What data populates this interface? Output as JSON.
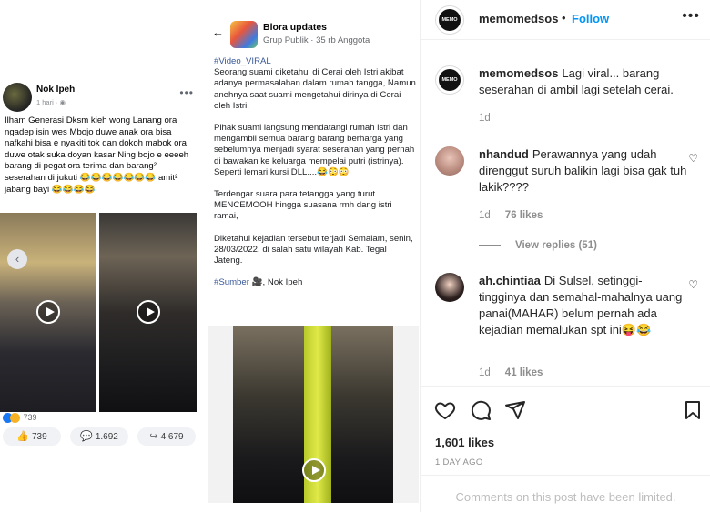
{
  "fb_post": {
    "author": "Nok Ipeh",
    "time": "1 hari",
    "text": "Ilham Generasi Dksm  kieh wong Lanang ora ngadep isin wes Mbojo duwe anak ora bisa nafkahi bisa e nyakiti tok dan dokoh mabok ora duwe otak suka doyan kasar Ning bojo e eeeeh barang di pegat ora terima dan barang² seserahan di jukuti 😂😂😂😂😂😂😂 amit² jabang bayi 😂😂😂😂",
    "reaction_count": "739",
    "actions": [
      {
        "icon": "👍",
        "label": "739"
      },
      {
        "icon": "💬",
        "label": "1.692"
      },
      {
        "icon": "↪",
        "label": "4.679"
      }
    ]
  },
  "group_post": {
    "group_name": "Blora updates",
    "group_meta": "Grup Publik  ·  35 rb Anggota",
    "hashtag": "#Video_VIRAL",
    "paragraphs": [
      "Seorang suami diketahui di Cerai oleh Istri akibat adanya permasalahan dalam rumah tangga, Namun anehnya saat suami mengetahui dirinya di Cerai oleh Istri.",
      "Pihak suami langsung mendatangi rumah istri dan mengambil semua barang barang berharga yang sebelumnya menjadi syarat seserahan yang pernah di bawakan ke keluarga mempelai putri (istrinya). Seperti lemari kursi DLL....😂😳😳",
      "Terdengar suara para tetangga yang turut MENCEMOOH hingga suasana rmh dang istri ramai,",
      "Diketahui kejadian tersebut terjadi Semalam, senin, 28/03/2022. di salah satu wilayah Kab. Tegal Jateng."
    ],
    "source_label": "#Sumber",
    "source_name": "🎥, Nok Ipeh"
  },
  "instagram": {
    "username": "memomedsos",
    "dot": "•",
    "follow_label": "Follow",
    "more_icon": "more-horizontal-icon",
    "caption": {
      "username": "memomedsos",
      "text": "Lagi viral... barang seserahan di ambil lagi setelah cerai.",
      "age": "1d"
    },
    "comments": [
      {
        "username": "nhandud",
        "text": "Perawannya yang udah direnggut suruh balikin lagi bisa gak tuh lakik????",
        "age": "1d",
        "likes": "76 likes"
      },
      {
        "username": "ah.chintiaa",
        "text": "Di Sulsel, setinggi-tingginya dan semahal-mahalnya uang panai(MAHAR) belum pernah ada kejadian memalukan spt ini😝😂",
        "age": "1d",
        "likes": "41 likes"
      }
    ],
    "view_replies": "View replies (51)",
    "likes_total": "1,601 likes",
    "posted": "1 DAY AGO",
    "comments_limited": "Comments on this post have been limited.",
    "logo_text": "MEMO MEDSOS"
  }
}
